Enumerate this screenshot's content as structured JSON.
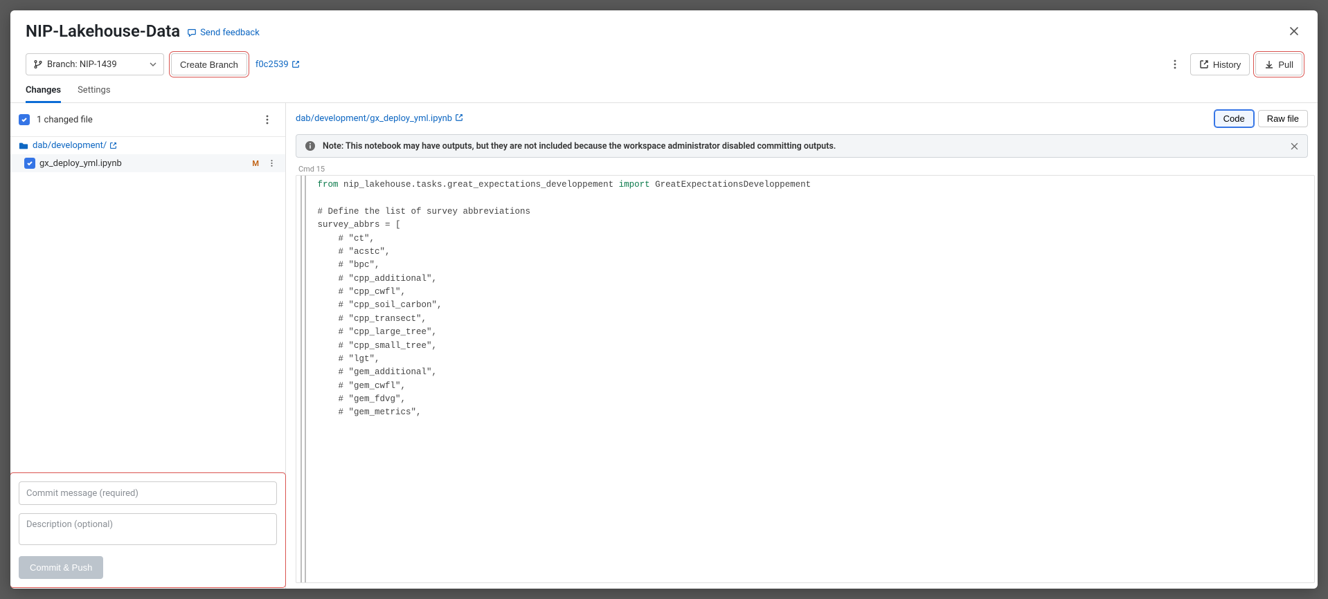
{
  "header": {
    "title": "NIP-Lakehouse-Data",
    "feedback_label": "Send feedback"
  },
  "toolbar": {
    "branch_label": "Branch: NIP-1439",
    "create_branch_label": "Create Branch",
    "commit_hash": "f0c2539",
    "history_label": "History",
    "pull_label": "Pull"
  },
  "tabs": {
    "changes": "Changes",
    "settings": "Settings"
  },
  "left": {
    "changed_files_label": "1 changed file",
    "folder_path": "dab/development/",
    "file_name": "gx_deploy_yml.ipynb",
    "mod_badge": "M",
    "commit_placeholder": "Commit message (required)",
    "desc_placeholder": "Description (optional)",
    "commit_push_label": "Commit & Push"
  },
  "right": {
    "file_path": "dab/development/gx_deploy_yml.ipynb",
    "code_toggle": "Code",
    "raw_toggle": "Raw file",
    "note_text": "Note: This notebook may have outputs, but they are not included because the workspace administrator disabled committing outputs.",
    "cmd_label": "Cmd 15",
    "code_lines": [
      "from nip_lakehouse.tasks.great_expectations_developpement import GreatExpectationsDeveloppement",
      "",
      "# Define the list of survey abbreviations",
      "survey_abbrs = [",
      "    # \"ct\",",
      "    # \"acstc\",",
      "    # \"bpc\",",
      "    # \"cpp_additional\",",
      "    # \"cpp_cwfl\",",
      "    # \"cpp_soil_carbon\",",
      "    # \"cpp_transect\",",
      "    # \"cpp_large_tree\",",
      "    # \"cpp_small_tree\",",
      "    # \"lgt\",",
      "    # \"gem_additional\",",
      "    # \"gem_cwfl\",",
      "    # \"gem_fdvg\",",
      "    # \"gem_metrics\","
    ]
  }
}
